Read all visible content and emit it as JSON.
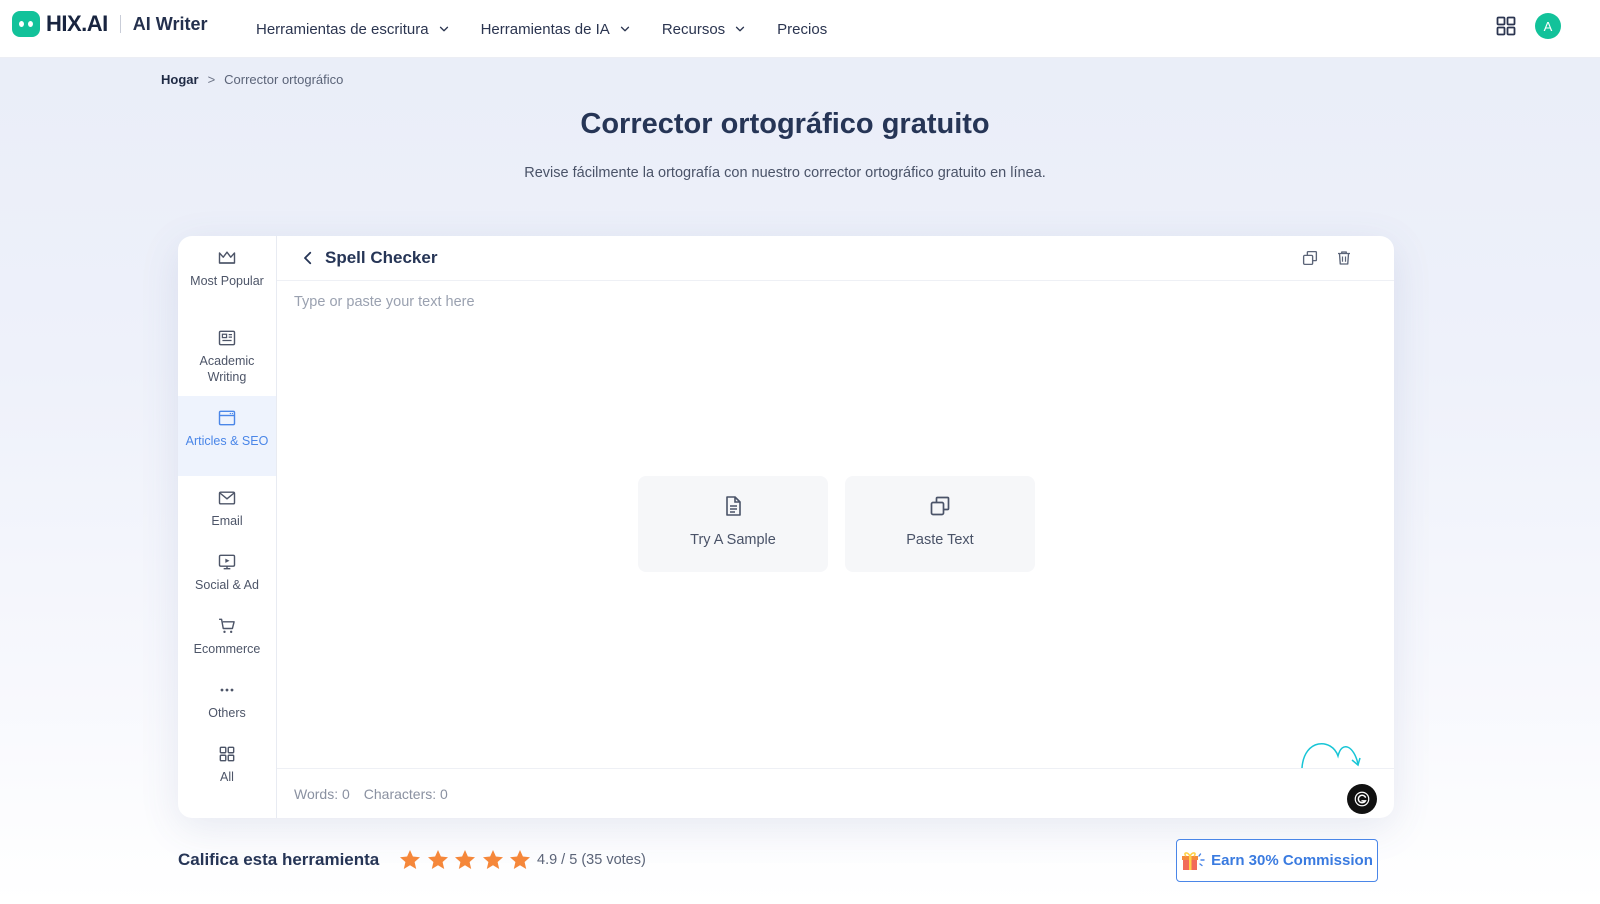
{
  "brand": {
    "logo_text": "HIX.AI",
    "product": "AI Writer",
    "accent": "#12c29a"
  },
  "nav": [
    {
      "label": "Herramientas de escritura"
    },
    {
      "label": "Herramientas de IA"
    },
    {
      "label": "Recursos"
    },
    {
      "label": "Precios"
    }
  ],
  "user": {
    "avatar_initial": "A"
  },
  "breadcrumb": {
    "home": "Hogar",
    "separator": ">",
    "current": "Corrector ortográfico"
  },
  "page": {
    "title": "Corrector ortográfico gratuito",
    "subtitle": "Revise fácilmente la ortografía con nuestro corrector ortográfico gratuito en línea."
  },
  "sidebar": {
    "items": [
      {
        "label": "Most Popular",
        "icon": "crown-icon"
      },
      {
        "label": "Academic Writing",
        "icon": "newspaper-icon"
      },
      {
        "label": "Articles & SEO",
        "icon": "browser-window-icon",
        "active": true
      },
      {
        "label": "Email",
        "icon": "mail-icon"
      },
      {
        "label": "Social & Ad",
        "icon": "monitor-play-icon"
      },
      {
        "label": "Ecommerce",
        "icon": "cart-icon"
      },
      {
        "label": "Others",
        "icon": "more-dots-icon"
      },
      {
        "label": "All",
        "icon": "grid-icon"
      }
    ]
  },
  "editor": {
    "tool_title": "Spell Checker",
    "placeholder": "Type or paste your text here",
    "value": "",
    "actions": {
      "sample_label": "Try A Sample",
      "paste_label": "Paste Text"
    },
    "footer": {
      "words": "Words: 0",
      "characters": "Characters: 0"
    }
  },
  "rating": {
    "label": "Califica esta herramienta",
    "stars": 5,
    "score_text": "4.9 / 5 (35 votes)",
    "star_color": "#f5873a"
  },
  "promo": {
    "label": "Earn 30% Commission",
    "color": "#3a7be0"
  }
}
